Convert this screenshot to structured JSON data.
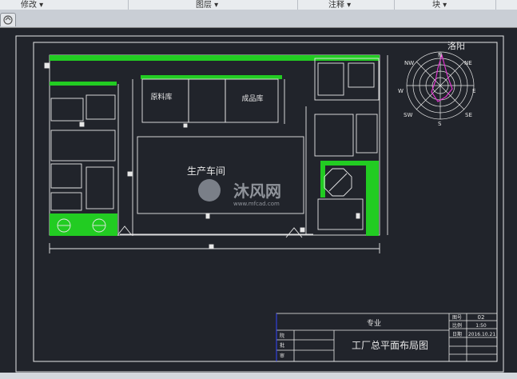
{
  "ribbon": {
    "modify_label": "修改 ▾",
    "layers_label": "图层 ▾",
    "annotate_label": "注释 ▾",
    "block_label": "块 ▾"
  },
  "tab": {
    "icon": "home-icon"
  },
  "drawing": {
    "compass_city": "洛阳",
    "dir_n": "N",
    "dir_ne": "NE",
    "dir_e": "E",
    "dir_se": "SE",
    "dir_s": "S",
    "dir_sw": "SW",
    "dir_w": "W",
    "dir_nw": "NW",
    "production_workshop": "生产车间",
    "raw_materials_warehouse": "原料库",
    "finished_goods_warehouse": "成品库",
    "watermark_name": "沐风网",
    "watermark_url": "www.mfcad.com",
    "accent_green": "#22cc22",
    "line_white": "#e8e8e8"
  },
  "title_block": {
    "specialty_label": "专业",
    "drawing_title": "工厂总平面布局图",
    "drawing_no_label": "图号",
    "drawing_no_value": "02",
    "scale_label": "比例",
    "scale_value": "1:50",
    "date_label": "日期",
    "date_value": "2016.10.21",
    "row_label_1": "院",
    "row_label_2": "批",
    "row_label_3": "审"
  }
}
